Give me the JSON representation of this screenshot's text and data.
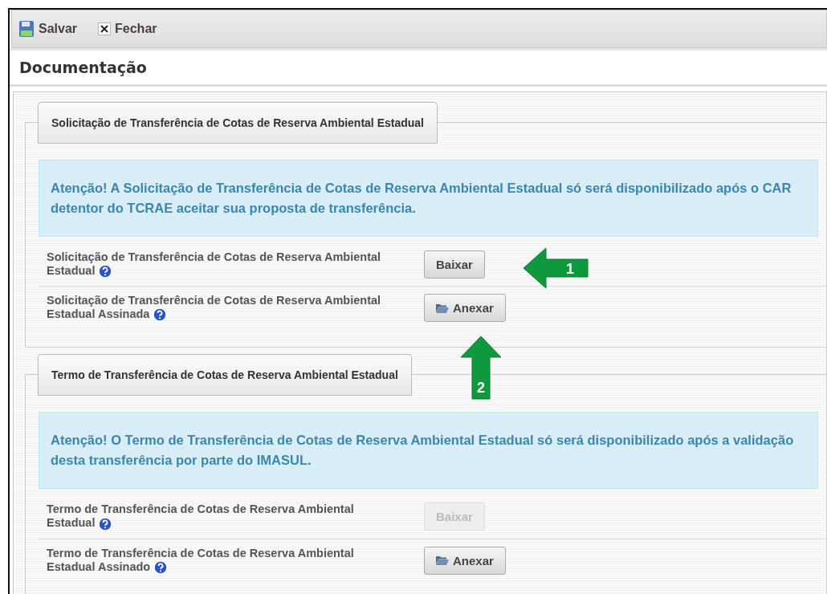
{
  "toolbar": [
    {
      "kind": "save",
      "label": "Salvar"
    },
    {
      "kind": "close",
      "label": "Fechar"
    }
  ],
  "title": "Documentação",
  "sections": [
    {
      "legend": "Solicitação de Transferência de Cotas de Reserva Ambiental Estadual",
      "alert": "Atenção! A Solicitação de Transferência de Cotas de Reserva Ambiental Estadual só será disponibilizado após o CAR detentor do TCRAE aceitar sua proposta de transferência.",
      "rows": [
        {
          "label": "Solicitação de Transferência de Cotas de Reserva Ambiental Estadual",
          "button": {
            "kind": "download",
            "label": "Baixar",
            "disabled": false
          }
        },
        {
          "label": "Solicitação de Transferência de Cotas de Reserva Ambiental Estadual Assinada",
          "button": {
            "kind": "attach",
            "label": "Anexar",
            "disabled": false
          }
        }
      ]
    },
    {
      "legend": "Termo de Transferência de Cotas de Reserva Ambiental Estadual",
      "alert": "Atenção! O Termo de Transferência de Cotas de Reserva Ambiental Estadual só será disponibilizado após a validação desta transferência por parte do IMASUL.",
      "rows": [
        {
          "label": "Termo de Transferência de Cotas de Reserva Ambiental Estadual",
          "button": {
            "kind": "download",
            "label": "Baixar",
            "disabled": true
          }
        },
        {
          "label": "Termo de Transferência de Cotas de Reserva Ambiental Estadual Assinado",
          "button": {
            "kind": "attach",
            "label": "Anexar",
            "disabled": false
          }
        }
      ]
    }
  ],
  "callouts": [
    {
      "number": "1",
      "kind": "left"
    },
    {
      "number": "2",
      "kind": "up"
    }
  ]
}
